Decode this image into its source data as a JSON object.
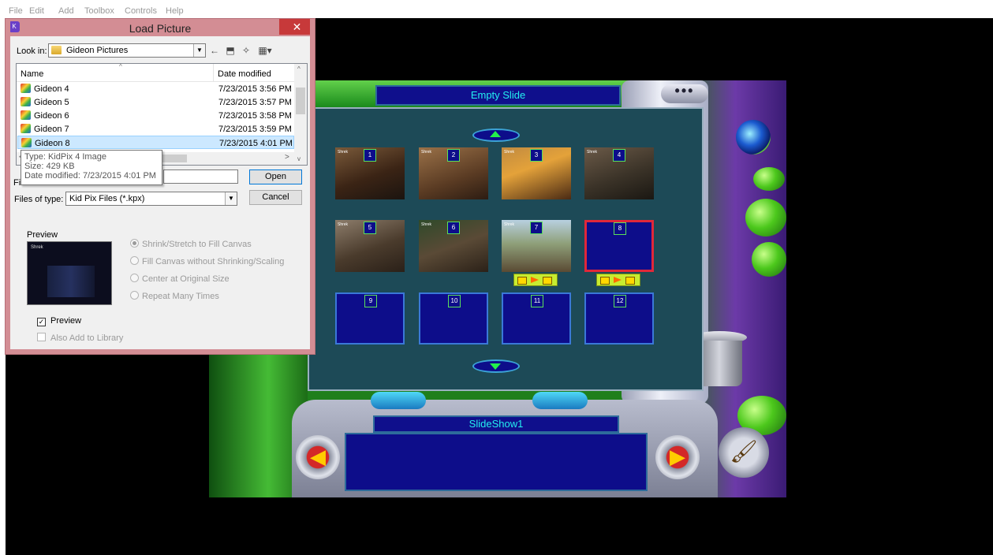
{
  "menu": [
    "File",
    "Edit",
    "Add",
    "Toolbox",
    "Controls",
    "Help"
  ],
  "kidpix": {
    "panel_title": "Empty Slide",
    "top_button": "•••",
    "slideshow_title": "SlideShow1",
    "slide_logo": "Shrek",
    "slides": [
      "1",
      "2",
      "3",
      "4",
      "5",
      "6",
      "7",
      "8",
      "9",
      "10",
      "11",
      "12"
    ]
  },
  "dialog": {
    "title": "Load Picture",
    "close": "✕",
    "look_in_label": "Look in:",
    "look_in_value": "Gideon Pictures",
    "columns": {
      "name": "Name",
      "date": "Date modified"
    },
    "files": [
      {
        "name": "Gideon 4",
        "date": "7/23/2015 3:56 PM"
      },
      {
        "name": "Gideon 5",
        "date": "7/23/2015 3:57 PM"
      },
      {
        "name": "Gideon 6",
        "date": "7/23/2015 3:58 PM"
      },
      {
        "name": "Gideon 7",
        "date": "7/23/2015 3:59 PM"
      },
      {
        "name": "Gideon 8",
        "date": "7/23/2015 4:01 PM"
      }
    ],
    "tooltip": {
      "type": "Type: KidPix 4 Image",
      "size": "Size: 429 KB",
      "modified": "Date modified: 7/23/2015 4:01 PM"
    },
    "filename_label": "Fi",
    "filename_value": "",
    "open_button": "Open",
    "files_of_type_label": "Files of type:",
    "files_of_type_value": "Kid Pix Files (*.kpx)",
    "cancel_button": "Cancel",
    "preview_label": "Preview",
    "preview_logo": "Shrek",
    "options": [
      "Shrink/Stretch to Fill Canvas",
      "Fill Canvas without Shrinking/Scaling",
      "Center at Original Size",
      "Repeat Many Times"
    ],
    "preview_check": "Preview",
    "library_check": "Also Add to Library"
  }
}
